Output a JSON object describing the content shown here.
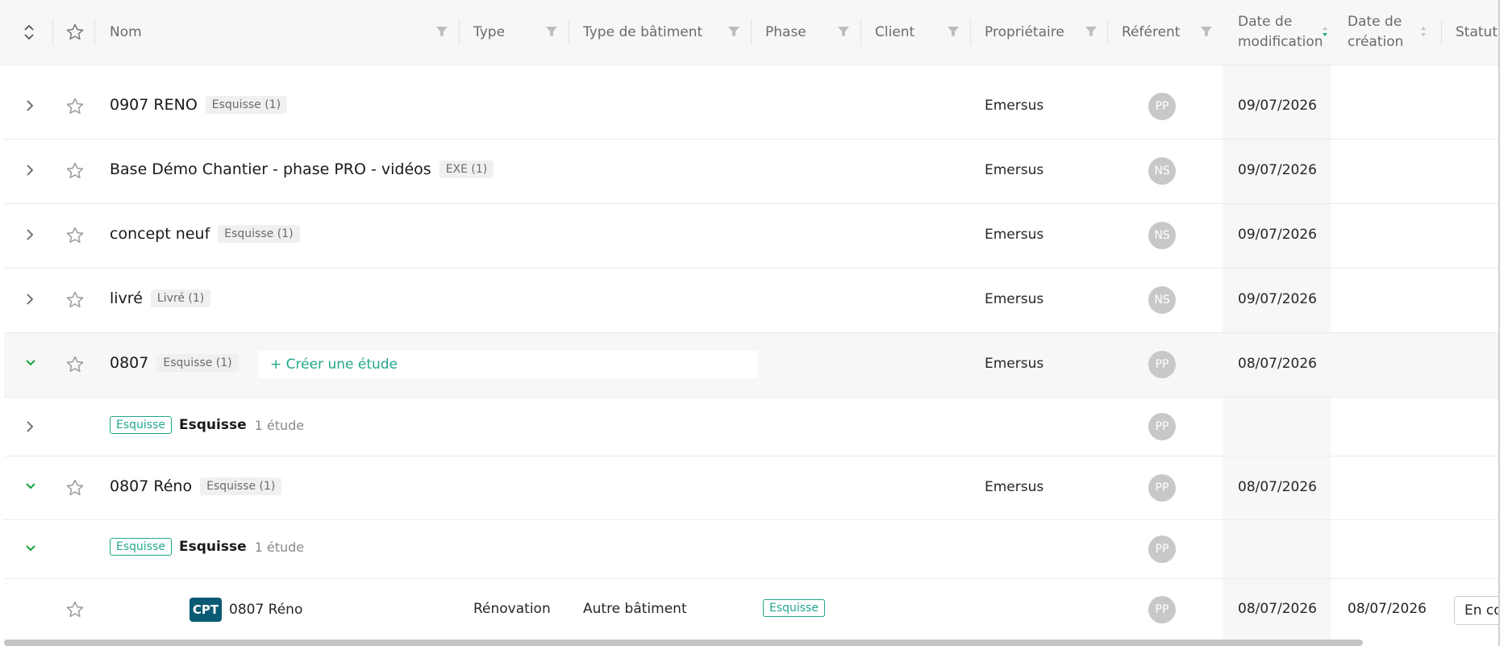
{
  "header": {
    "columns": {
      "name": "Nom",
      "type": "Type",
      "building_type": "Type de bâtiment",
      "phase": "Phase",
      "client": "Client",
      "owner": "Propriétaire",
      "referent": "Référent",
      "modified_line1": "Date de",
      "modified_line2": "modification",
      "created_line1": "Date de",
      "created_line2": "création",
      "status": "Statut d"
    }
  },
  "rows": [
    {
      "name": "0907 RENO",
      "tag": "Esquisse (1)",
      "owner": "Emersus",
      "referent": "PP",
      "modified": "09/07/2026"
    },
    {
      "name": "Base Démo Chantier - phase PRO - vidéos",
      "tag": "EXE (1)",
      "owner": "Emersus",
      "referent": "NS",
      "modified": "09/07/2026"
    },
    {
      "name": "concept neuf",
      "tag": "Esquisse (1)",
      "owner": "Emersus",
      "referent": "NS",
      "modified": "09/07/2026"
    },
    {
      "name": "livré",
      "tag": "Livré (1)",
      "owner": "Emersus",
      "referent": "NS",
      "modified": "09/07/2026"
    },
    {
      "name": "0807",
      "tag": "Esquisse (1)",
      "create_label": "+ Créer une étude",
      "owner": "Emersus",
      "referent": "PP",
      "modified": "08/07/2026"
    },
    {
      "phase_tag": "Esquisse",
      "phase_name": "Esquisse",
      "count": "1 étude",
      "referent": "PP"
    },
    {
      "name": "0807 Réno",
      "tag": "Esquisse (1)",
      "owner": "Emersus",
      "referent": "PP",
      "modified": "08/07/2026"
    },
    {
      "phase_tag": "Esquisse",
      "phase_name": "Esquisse",
      "count": "1 étude",
      "referent": "PP"
    },
    {
      "badge": "CPT",
      "name": "0807 Réno",
      "type": "Rénovation",
      "building_type": "Autre bâtiment",
      "phase": "Esquisse",
      "referent": "PP",
      "modified": "08/07/2026",
      "created": "08/07/2026",
      "status": "En cours"
    }
  ],
  "colors": {
    "accent": "#22a78c",
    "expand_green": "#1aa33a",
    "cpt_badge": "#0b5a73",
    "avatar": "#c8c8c8"
  }
}
